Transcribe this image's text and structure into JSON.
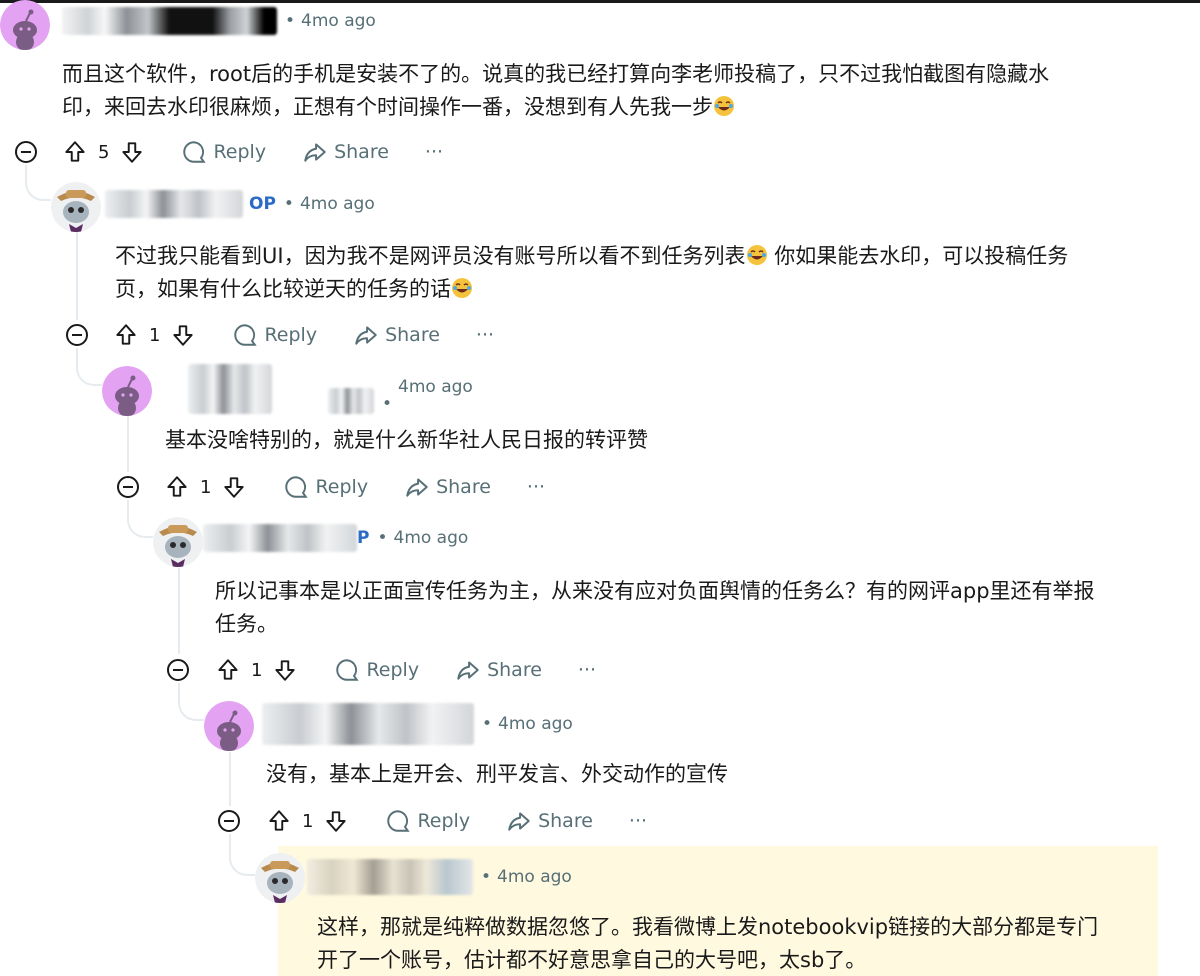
{
  "comments": [
    {
      "id": "c1",
      "is_op": false,
      "author_suffix": "",
      "time": "4mo ago",
      "lines": [
        "而且这个软件，root后的手机是安装不了的。说真的我已经打算向李老师投稿了，只不过我怕截图有隐藏水",
        "印，来回去水印很麻烦，正想有个时间操作一番，没想到有人先我一步"
      ],
      "votes": "5",
      "reply_label": "Reply",
      "share_label": "Share",
      "more_label": "···",
      "avatar": "snoo-purple-icon"
    },
    {
      "id": "c2",
      "is_op": true,
      "author_suffix": "OP",
      "time": "4mo ago",
      "lines": [
        "不过我只能看到UI，因为我不是网评员没有账号所以看不到任务列表",
        "页，如果有什么比较逆天的任务的话"
      ],
      "line1_tail": " 你如果能去水印，可以投稿任务",
      "votes": "1",
      "reply_label": "Reply",
      "share_label": "Share",
      "more_label": "···",
      "avatar": "snoo-hat-icon"
    },
    {
      "id": "c3",
      "is_op": false,
      "author_suffix": "",
      "time": "4mo ago",
      "lines": [
        "基本没啥特别的，就是什么新华社人民日报的转评赞"
      ],
      "votes": "1",
      "reply_label": "Reply",
      "share_label": "Share",
      "more_label": "···",
      "avatar": "snoo-purple-icon"
    },
    {
      "id": "c4",
      "is_op": true,
      "author_suffix": "P",
      "time": "4mo ago",
      "lines": [
        "所以记事本是以正面宣传任务为主，从来没有应对负面舆情的任务么？有的网评app里还有举报",
        "任务。"
      ],
      "votes": "1",
      "reply_label": "Reply",
      "share_label": "Share",
      "more_label": "···",
      "avatar": "snoo-hat-icon"
    },
    {
      "id": "c5",
      "is_op": false,
      "author_suffix": "",
      "time": "4mo ago",
      "lines": [
        "没有，基本上是开会、刑平发言、外交动作的宣传"
      ],
      "votes": "1",
      "reply_label": "Reply",
      "share_label": "Share",
      "more_label": "···",
      "avatar": "snoo-purple-icon"
    },
    {
      "id": "c6",
      "is_op": true,
      "author_suffix": "",
      "time": "4mo ago",
      "lines": [
        "这样，那就是纯粹做数据忽悠了。我看微博上发notebookvip链接的大部分都是专门",
        "开了一个账号，估计都不好意思拿自己的大号吧，太sb了。"
      ],
      "votes": "",
      "reply_label": "",
      "share_label": "",
      "more_label": "",
      "avatar": "snoo-hat-icon"
    }
  ],
  "colors": {
    "op": "#2a6bc7",
    "meta": "#576f76",
    "highlight": "#fff9df",
    "thread_line": "#e5ebee",
    "avatar_purple": "#e4a3f2"
  }
}
